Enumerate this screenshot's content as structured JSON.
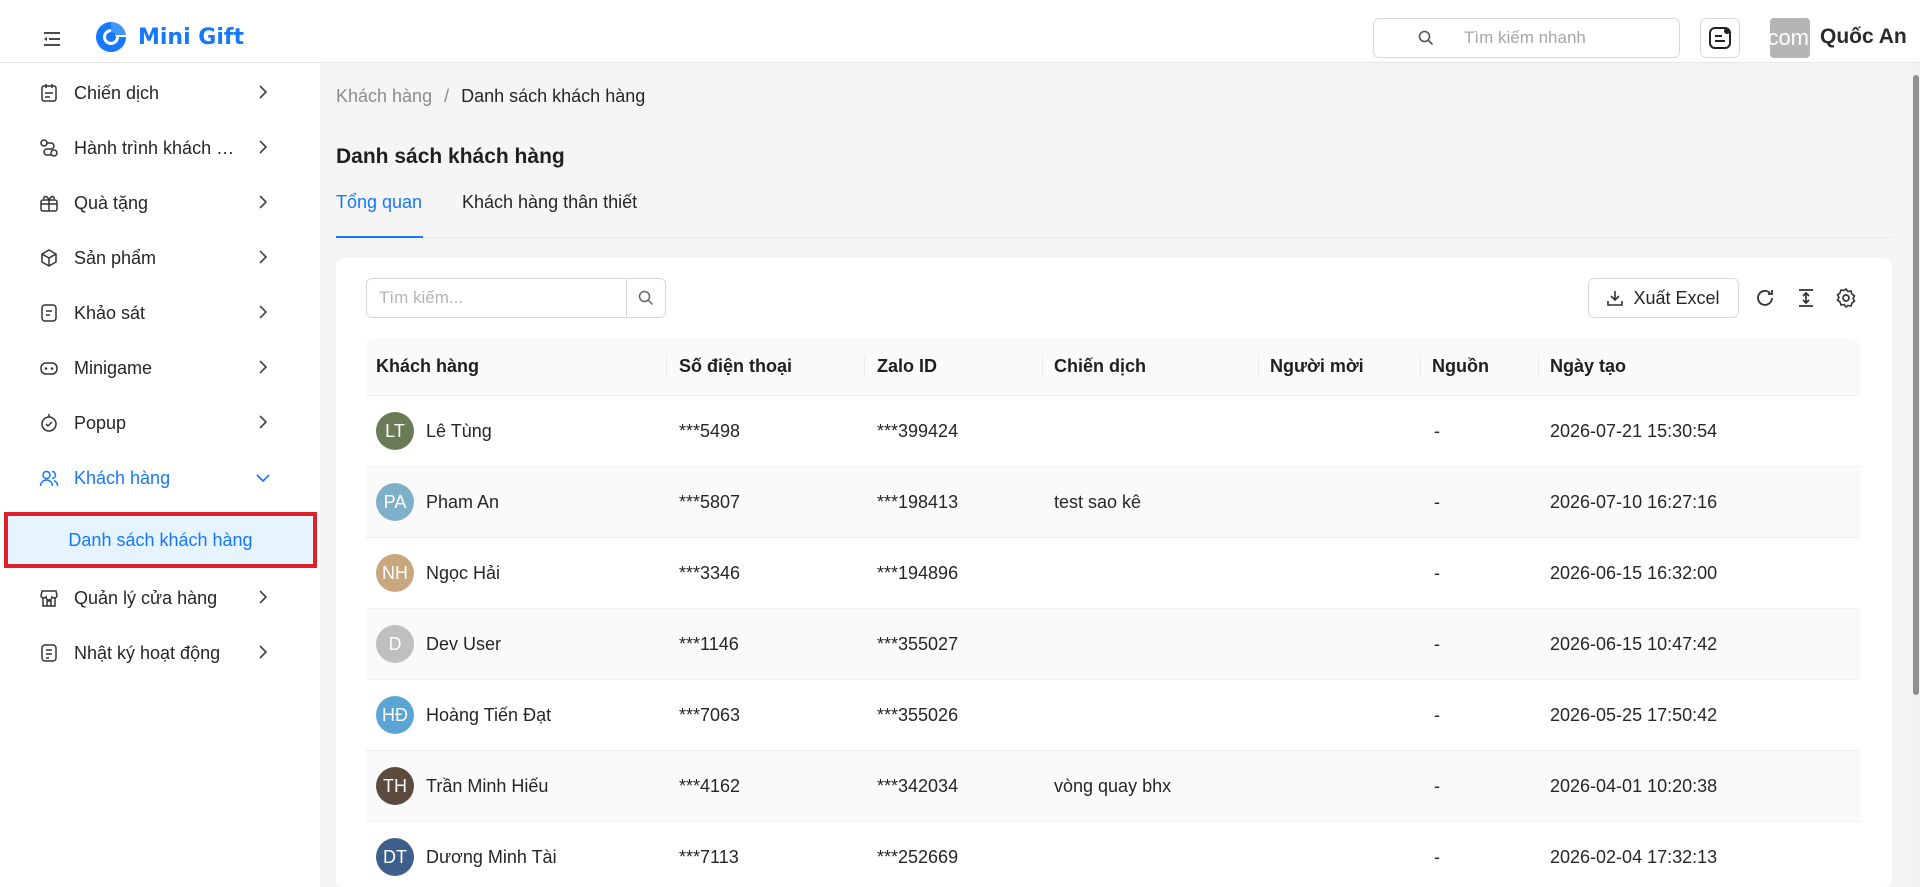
{
  "header": {
    "app_name": "Mini Gift",
    "quick_search_placeholder": "Tìm kiếm nhanh",
    "user_avatar_text": "com",
    "user_name": "Quốc An"
  },
  "sidebar": {
    "items": [
      {
        "label": "Chiến dịch",
        "icon": "campaign-icon"
      },
      {
        "label": "Hành trình khách hàng",
        "icon": "journey-icon"
      },
      {
        "label": "Quà tặng",
        "icon": "gift-icon"
      },
      {
        "label": "Sản phẩm",
        "icon": "box-icon"
      },
      {
        "label": "Khảo sát",
        "icon": "survey-icon"
      },
      {
        "label": "Minigame",
        "icon": "gamepad-icon"
      },
      {
        "label": "Popup",
        "icon": "popup-icon"
      },
      {
        "label": "Khách hàng",
        "icon": "users-icon"
      },
      {
        "label": "Quản lý cửa hàng",
        "icon": "store-icon"
      },
      {
        "label": "Nhật ký hoạt động",
        "icon": "log-icon"
      }
    ],
    "sub_active": "Danh sách khách hàng"
  },
  "breadcrumb": {
    "parent": "Khách hàng",
    "separator": "/",
    "current": "Danh sách khách hàng"
  },
  "page_title": "Danh sách khách hàng",
  "tabs": [
    {
      "label": "Tổng quan"
    },
    {
      "label": "Khách hàng thân thiết"
    }
  ],
  "toolbar": {
    "search_placeholder": "Tìm kiếm...",
    "export_label": "Xuất Excel"
  },
  "table": {
    "headers": [
      "Khách hàng",
      "Số điện thoại",
      "Zalo ID",
      "Chiến dịch",
      "Người mời",
      "Nguồn",
      "Ngày tạo"
    ],
    "rows": [
      {
        "name": "Lê Tùng",
        "avatar": "LT",
        "phone": "***5498",
        "zalo": "***399424",
        "campaign": "",
        "inviter": "",
        "source": "-",
        "created": "2026-07-21 15:30:54"
      },
      {
        "name": "Pham An",
        "avatar": "PA",
        "phone": "***5807",
        "zalo": "***198413",
        "campaign": "test sao kê",
        "inviter": "",
        "source": "-",
        "created": "2026-07-10 16:27:16"
      },
      {
        "name": "Ngọc Hải",
        "avatar": "NH",
        "phone": "***3346",
        "zalo": "***194896",
        "campaign": "",
        "inviter": "",
        "source": "-",
        "created": "2026-06-15 16:32:00"
      },
      {
        "name": "Dev User",
        "avatar": "D",
        "phone": "***1146",
        "zalo": "***355027",
        "campaign": "",
        "inviter": "",
        "source": "-",
        "created": "2026-06-15 10:47:42"
      },
      {
        "name": "Hoàng Tiến Đạt",
        "avatar": "HĐ",
        "phone": "***7063",
        "zalo": "***355026",
        "campaign": "",
        "inviter": "",
        "source": "-",
        "created": "2026-05-25 17:50:42"
      },
      {
        "name": "Trần Minh Hiếu",
        "avatar": "TH",
        "phone": "***4162",
        "zalo": "***342034",
        "campaign": "vòng quay bhx",
        "inviter": "",
        "source": "-",
        "created": "2026-04-01 10:20:38"
      },
      {
        "name": "Dương Minh Tài",
        "avatar": "DT",
        "phone": "***7113",
        "zalo": "***252669",
        "campaign": "",
        "inviter": "",
        "source": "-",
        "created": "2026-02-04 17:32:13"
      }
    ]
  },
  "colors": {
    "accent": "#1677ff",
    "active_bg": "#e6f4ff",
    "highlight_border": "#e0202a"
  }
}
